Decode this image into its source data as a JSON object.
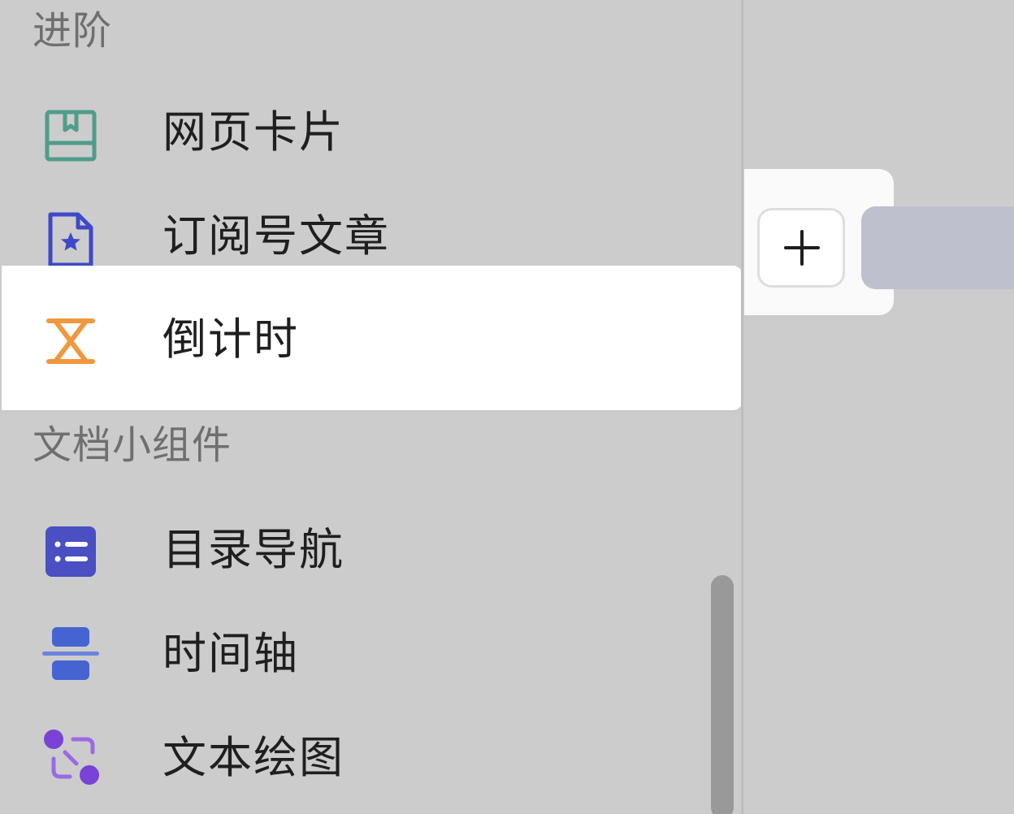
{
  "sections": {
    "advanced": {
      "title": "进阶",
      "items": [
        {
          "label": "网页卡片",
          "icon": "web-card-icon"
        },
        {
          "label": "订阅号文章",
          "icon": "subscription-article-icon"
        },
        {
          "label": "倒计时",
          "icon": "hourglass-icon",
          "state": "hovered"
        }
      ]
    },
    "widgets": {
      "title": "文档小组件",
      "items": [
        {
          "label": "目录导航",
          "icon": "table-of-contents-icon"
        },
        {
          "label": "时间轴",
          "icon": "timeline-icon"
        },
        {
          "label": "文本绘图",
          "icon": "text-diagram-icon"
        }
      ]
    }
  },
  "add_button": {
    "icon": "plus-icon"
  },
  "colors": {
    "panel_bg": "#cccccc",
    "hover_bg": "#ffffff",
    "section_header": "#6f6f6f",
    "label": "#1f1f1f",
    "web_card_icon": "#4f9d8a",
    "subscription_icon": "#3f49c7",
    "hourglass_icon": "#f0983f",
    "toc_icon": "#4a4fc2",
    "timeline_icon": "#4564d2",
    "diagram_icon": "#7a42d6",
    "selection_highlight": "#bec0cd"
  }
}
